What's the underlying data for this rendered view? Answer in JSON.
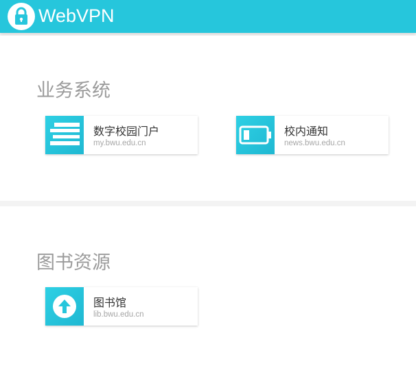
{
  "header": {
    "brand": "WebVPN",
    "logo_icon": "lock-icon",
    "color": "#26c6dc"
  },
  "sections": [
    {
      "title": "业务系统",
      "items": [
        {
          "title": "数字校园门户",
          "url": "my.bwu.edu.cn",
          "icon": "list-lines-icon"
        },
        {
          "title": "校内通知",
          "url": "news.bwu.edu.cn",
          "icon": "battery-icon"
        }
      ]
    },
    {
      "title": "图书资源",
      "items": [
        {
          "title": "图书馆",
          "url": "lib.bwu.edu.cn",
          "icon": "arrow-up-circle-icon"
        }
      ]
    }
  ],
  "colors": {
    "accent": "#26c6dc",
    "title_gray": "#9b9b9b",
    "url_gray": "#a6a6a6"
  }
}
